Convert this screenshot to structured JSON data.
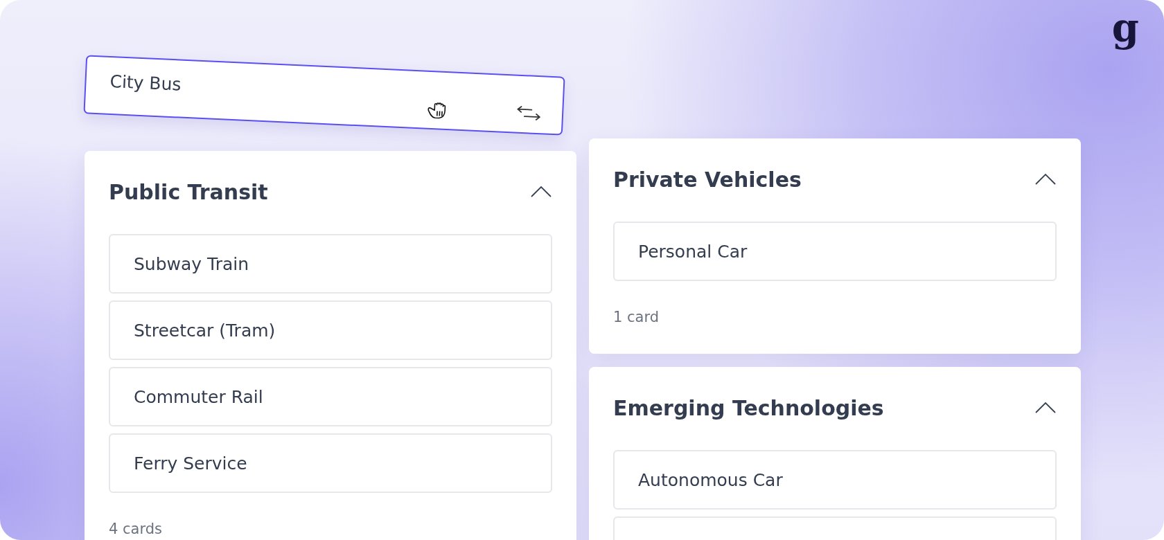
{
  "logo": "g",
  "dragging_card": {
    "label": "City Bus"
  },
  "columns": [
    [
      {
        "title": "Public Transit",
        "expanded": true,
        "cards": [
          {
            "label": "Subway Train"
          },
          {
            "label": "Streetcar (Tram)"
          },
          {
            "label": "Commuter Rail"
          },
          {
            "label": "Ferry Service"
          }
        ],
        "count": "4 cards",
        "more_below": false
      }
    ],
    [
      {
        "title": "Private Vehicles",
        "expanded": true,
        "cards": [
          {
            "label": "Personal Car"
          }
        ],
        "count": "1 card",
        "more_below": false
      },
      {
        "title": "Emerging Technologies",
        "expanded": true,
        "cards": [
          {
            "label": "Autonomous Car"
          }
        ],
        "more_below": true
      }
    ]
  ]
}
